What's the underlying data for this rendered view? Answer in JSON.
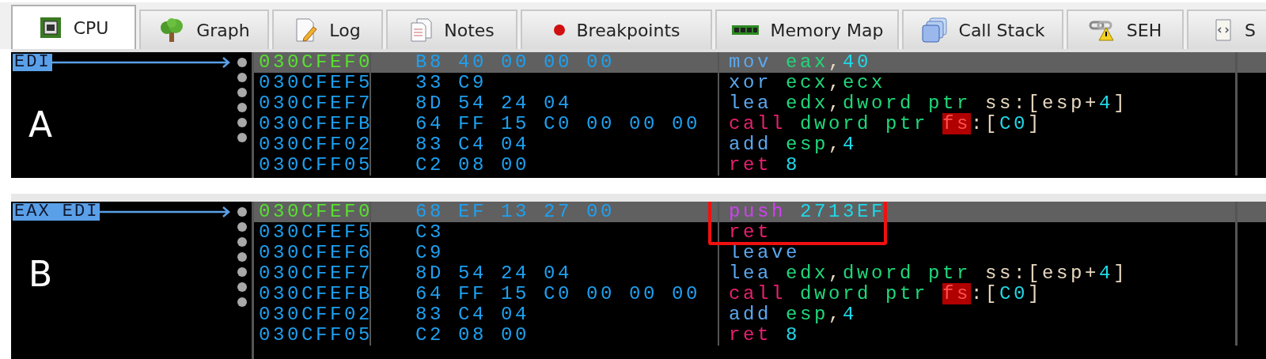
{
  "tabs": [
    {
      "label": "CPU",
      "selected": true
    },
    {
      "label": "Graph",
      "selected": false
    },
    {
      "label": "Log",
      "selected": false
    },
    {
      "label": "Notes",
      "selected": false
    },
    {
      "label": "Breakpoints",
      "selected": false
    },
    {
      "label": "Memory Map",
      "selected": false
    },
    {
      "label": "Call Stack",
      "selected": false
    },
    {
      "label": "SEH",
      "selected": false
    },
    {
      "label": "S",
      "selected": false
    }
  ],
  "panels": [
    {
      "label": "A",
      "register_label": "EDI",
      "rows": [
        {
          "address": "030CFEF0",
          "bytes": "B8 40 00 00 00",
          "selected": true,
          "boxed": false,
          "tokens": [
            {
              "text": "mov ",
              "kind": "op"
            },
            {
              "text": "eax",
              "kind": "reg"
            },
            {
              "text": ",",
              "kind": "plain"
            },
            {
              "text": "40",
              "kind": "num"
            }
          ]
        },
        {
          "address": "030CFEF5",
          "bytes": "33 C9",
          "selected": false,
          "boxed": false,
          "tokens": [
            {
              "text": "xor ",
              "kind": "op"
            },
            {
              "text": "ecx",
              "kind": "reg"
            },
            {
              "text": ",",
              "kind": "plain"
            },
            {
              "text": "ecx",
              "kind": "reg"
            }
          ]
        },
        {
          "address": "030CFEF7",
          "bytes": "8D 54 24 04",
          "selected": false,
          "boxed": false,
          "tokens": [
            {
              "text": "lea ",
              "kind": "op"
            },
            {
              "text": "edx",
              "kind": "reg"
            },
            {
              "text": ",",
              "kind": "plain"
            },
            {
              "text": "dword ptr ",
              "kind": "reg"
            },
            {
              "text": "ss:[esp+",
              "kind": "plain"
            },
            {
              "text": "4",
              "kind": "num"
            },
            {
              "text": "]",
              "kind": "plain"
            }
          ]
        },
        {
          "address": "030CFEFB",
          "bytes": "64 FF 15 C0 00 00 00",
          "selected": false,
          "boxed": false,
          "tokens": [
            {
              "text": "call ",
              "kind": "branch"
            },
            {
              "text": "dword ptr ",
              "kind": "reg"
            },
            {
              "text": "fs",
              "kind": "segment"
            },
            {
              "text": ":[",
              "kind": "plain"
            },
            {
              "text": "C0",
              "kind": "num"
            },
            {
              "text": "]",
              "kind": "plain"
            }
          ]
        },
        {
          "address": "030CFF02",
          "bytes": "83 C4 04",
          "selected": false,
          "boxed": false,
          "tokens": [
            {
              "text": "add ",
              "kind": "op"
            },
            {
              "text": "esp",
              "kind": "reg"
            },
            {
              "text": ",",
              "kind": "plain"
            },
            {
              "text": "4",
              "kind": "num"
            }
          ]
        },
        {
          "address": "030CFF05",
          "bytes": "C2 08 00",
          "selected": false,
          "boxed": false,
          "tokens": [
            {
              "text": "ret ",
              "kind": "branch"
            },
            {
              "text": "8",
              "kind": "num"
            }
          ]
        }
      ]
    },
    {
      "label": "B",
      "register_label": "EAX EDI",
      "rows": [
        {
          "address": "030CFEF0",
          "bytes": "68 EF 13 27 00",
          "selected": true,
          "boxed": true,
          "tokens": [
            {
              "text": "push ",
              "kind": "push"
            },
            {
              "text": "2713EF",
              "kind": "num"
            }
          ]
        },
        {
          "address": "030CFEF5",
          "bytes": "C3",
          "selected": false,
          "boxed": true,
          "tokens": [
            {
              "text": "ret",
              "kind": "branch"
            }
          ]
        },
        {
          "address": "030CFEF6",
          "bytes": "C9",
          "selected": false,
          "boxed": false,
          "tokens": [
            {
              "text": "leave",
              "kind": "op"
            }
          ]
        },
        {
          "address": "030CFEF7",
          "bytes": "8D 54 24 04",
          "selected": false,
          "boxed": false,
          "tokens": [
            {
              "text": "lea ",
              "kind": "op"
            },
            {
              "text": "edx",
              "kind": "reg"
            },
            {
              "text": ",",
              "kind": "plain"
            },
            {
              "text": "dword ptr ",
              "kind": "reg"
            },
            {
              "text": "ss:[esp+",
              "kind": "plain"
            },
            {
              "text": "4",
              "kind": "num"
            },
            {
              "text": "]",
              "kind": "plain"
            }
          ]
        },
        {
          "address": "030CFEFB",
          "bytes": "64 FF 15 C0 00 00 00",
          "selected": false,
          "boxed": false,
          "tokens": [
            {
              "text": "call ",
              "kind": "branch"
            },
            {
              "text": "dword ptr ",
              "kind": "reg"
            },
            {
              "text": "fs",
              "kind": "segment"
            },
            {
              "text": ":[",
              "kind": "plain"
            },
            {
              "text": "C0",
              "kind": "num"
            },
            {
              "text": "]",
              "kind": "plain"
            }
          ]
        },
        {
          "address": "030CFF02",
          "bytes": "83 C4 04",
          "selected": false,
          "boxed": false,
          "tokens": [
            {
              "text": "add ",
              "kind": "op"
            },
            {
              "text": "esp",
              "kind": "reg"
            },
            {
              "text": ",",
              "kind": "plain"
            },
            {
              "text": "4",
              "kind": "num"
            }
          ]
        },
        {
          "address": "030CFF05",
          "bytes": "C2 08 00",
          "selected": false,
          "boxed": false,
          "tokens": [
            {
              "text": "ret ",
              "kind": "branch"
            },
            {
              "text": "8",
              "kind": "num"
            }
          ]
        }
      ]
    }
  ]
}
